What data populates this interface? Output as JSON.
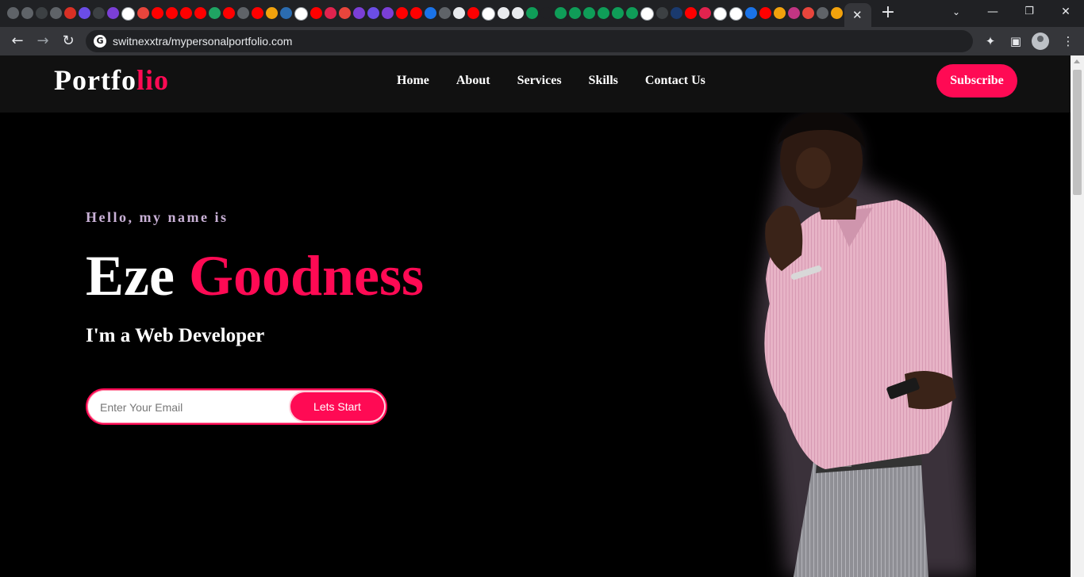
{
  "browser": {
    "url": "switnexxtra/mypersonalportfolio.com",
    "tab_icons": [
      {
        "name": "chrome-icon",
        "color": "#5f6368"
      },
      {
        "name": "chrome-icon",
        "color": "#5f6368"
      },
      {
        "name": "app-icon",
        "color": "#3c4043"
      },
      {
        "name": "chrome-icon",
        "color": "#5f6368"
      },
      {
        "name": "red-v-icon",
        "color": "#d93025"
      },
      {
        "name": "purple-d-icon",
        "color": "#6b4de6"
      },
      {
        "name": "drive-icon",
        "color": "#3c4043"
      },
      {
        "name": "shield-icon",
        "color": "#7b3fd6"
      },
      {
        "name": "google-icon",
        "color": "#ffffff"
      },
      {
        "name": "pin-icon",
        "color": "#e8453c"
      },
      {
        "name": "youtube-icon",
        "color": "#ff0000"
      },
      {
        "name": "youtube-icon",
        "color": "#ff0000"
      },
      {
        "name": "youtube-icon",
        "color": "#ff0000"
      },
      {
        "name": "youtube-icon",
        "color": "#ff0000"
      },
      {
        "name": "drive-icon",
        "color": "#1fa463"
      },
      {
        "name": "youtube-icon",
        "color": "#ff0000"
      },
      {
        "name": "chrome-icon",
        "color": "#5f6368"
      },
      {
        "name": "youtube-icon",
        "color": "#ff0000"
      },
      {
        "name": "lock-icon",
        "color": "#f2a20c"
      },
      {
        "name": "feather-icon",
        "color": "#2b6cb0"
      },
      {
        "name": "google-icon",
        "color": "#ffffff"
      },
      {
        "name": "youtube-icon",
        "color": "#ff0000"
      },
      {
        "name": "nest-icon",
        "color": "#e0234e"
      },
      {
        "name": "x-icon",
        "color": "#e8453c"
      },
      {
        "name": "shield-icon",
        "color": "#7b3fd6"
      },
      {
        "name": "code-icon",
        "color": "#6b4de6"
      },
      {
        "name": "shield-icon",
        "color": "#7b3fd6"
      },
      {
        "name": "youtube-icon",
        "color": "#ff0000"
      },
      {
        "name": "youtube-icon",
        "color": "#ff0000"
      },
      {
        "name": "download-icon",
        "color": "#1a73e8"
      },
      {
        "name": "chrome-icon",
        "color": "#5f6368"
      },
      {
        "name": "github-icon",
        "color": "#e8eaed"
      },
      {
        "name": "youtube-icon",
        "color": "#ff0000"
      },
      {
        "name": "google-icon",
        "color": "#ffffff"
      },
      {
        "name": "github-icon",
        "color": "#e8eaed"
      },
      {
        "name": "github-icon",
        "color": "#e8eaed"
      },
      {
        "name": "w-icon",
        "color": "#0f9d58"
      },
      {
        "name": "f-icon",
        "color": "#202124"
      },
      {
        "name": "w-icon",
        "color": "#0f9d58"
      },
      {
        "name": "w-icon",
        "color": "#0f9d58"
      },
      {
        "name": "w-icon",
        "color": "#0f9d58"
      },
      {
        "name": "w-icon",
        "color": "#0f9d58"
      },
      {
        "name": "w-icon",
        "color": "#0f9d58"
      },
      {
        "name": "w-icon",
        "color": "#0f9d58"
      },
      {
        "name": "google-icon",
        "color": "#ffffff"
      },
      {
        "name": "app-icon",
        "color": "#3c4043"
      },
      {
        "name": "app-icon",
        "color": "#1a3a6e"
      },
      {
        "name": "youtube-icon",
        "color": "#ff0000"
      },
      {
        "name": "nest-icon",
        "color": "#e0234e"
      },
      {
        "name": "google-icon",
        "color": "#ffffff"
      },
      {
        "name": "google-icon",
        "color": "#ffffff"
      },
      {
        "name": "gear-icon",
        "color": "#1a73e8"
      },
      {
        "name": "youtube-icon",
        "color": "#ff0000"
      },
      {
        "name": "g-icon",
        "color": "#f2a20c"
      },
      {
        "name": "instagram-icon",
        "color": "#c13584"
      },
      {
        "name": "code-icon",
        "color": "#e8453c"
      },
      {
        "name": "chrome-icon",
        "color": "#5f6368"
      },
      {
        "name": "app-icon",
        "color": "#f2a20c"
      }
    ]
  },
  "site": {
    "logo_main": "Portfo",
    "logo_accent": "lio",
    "nav": [
      "Home",
      "About",
      "Services",
      "Skills",
      "Contact Us"
    ],
    "subscribe_label": "Subscribe"
  },
  "hero": {
    "greeting": "Hello, my name is",
    "first_name": "Eze",
    "last_name": "Goodness",
    "role": "I'm a Web Developer",
    "email_placeholder": "Enter Your Email",
    "cta_label": "Lets Start"
  },
  "colors": {
    "accent": "#ff0a54",
    "header_bg": "#111111",
    "page_bg": "#000000",
    "greeting": "#c9b1d6"
  }
}
